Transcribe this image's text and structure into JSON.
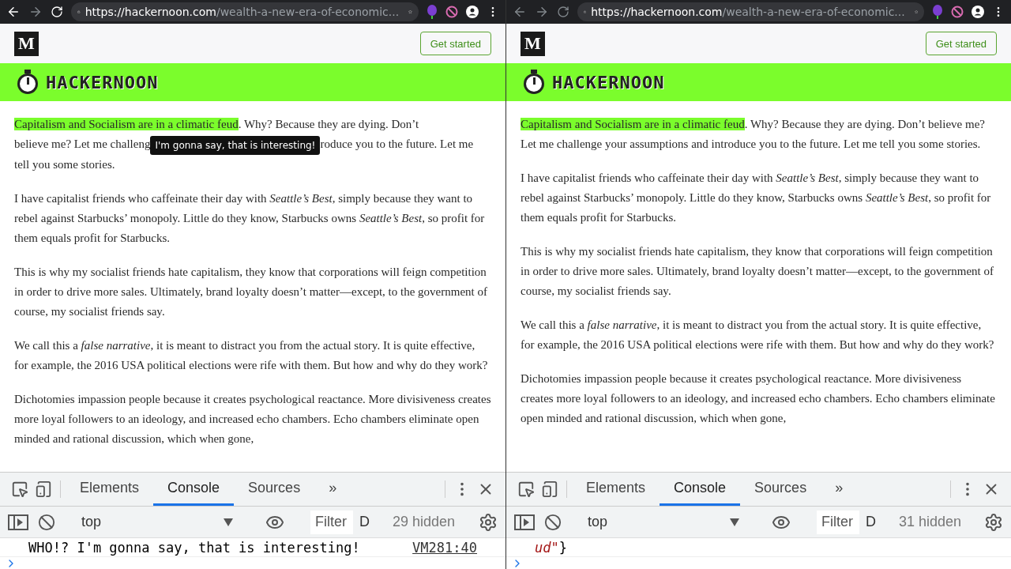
{
  "windows": [
    {
      "focused": true,
      "back_enabled": true,
      "forward_enabled": false,
      "url": {
        "host": "https://hackernoon.com",
        "path": "/wealth-a-new-era-of-economic..."
      },
      "site": {
        "logo": "M",
        "button": "Get started",
        "brand": "HACKERNOON"
      },
      "paragraphs": [
        {
          "segments": [
            {
              "kind": "highlight",
              "text": "Capitalism and Socialism are in a climatic feud"
            },
            {
              "kind": "text",
              "text": ". Why? Because they are dying. Don’t"
            },
            {
              "kind": "break"
            },
            {
              "kind": "text",
              "text": "believe me? Let me challeng"
            },
            {
              "kind": "tooltip",
              "text": "I'm gonna say, that is interesting!"
            },
            {
              "kind": "text",
              "text": "roduce you to the future. Let me"
            },
            {
              "kind": "break"
            },
            {
              "kind": "text",
              "text": "tell you some stories."
            }
          ]
        },
        {
          "segments": [
            {
              "kind": "text",
              "text": "I have capitalist friends who caffeinate their day with *Seattle’s Best*, simply because they want to rebel against Starbucks’ monopoly. Little do they know, Starbucks owns *Seattle’s Best*, so profit for them equals profit for Starbucks."
            }
          ]
        },
        {
          "segments": [
            {
              "kind": "text",
              "text": "This is why my socialist friends hate capitalism, they know that corporations will feign competition in order to drive more sales. Ultimately, brand loyalty doesn’t matter—except, to the government of course, my socialist friends say."
            }
          ]
        },
        {
          "segments": [
            {
              "kind": "text",
              "text": "We call this a *false narrative*, it is meant to distract you from the actual story. It is quite effective, for example, the 2016 USA political elections were rife with them. But how and why do they work?"
            }
          ]
        },
        {
          "segments": [
            {
              "kind": "text",
              "text": "Dichotomies impassion people because it creates psychological reactance. More divisiveness creates more loyal followers to an ideology, and increased echo chambers. Echo chambers eliminate open minded and rational discussion, which when gone,"
            }
          ]
        }
      ],
      "devtools": {
        "tabs": [
          {
            "label": "Elements",
            "selected": false
          },
          {
            "label": "Console",
            "selected": true
          },
          {
            "label": "Sources",
            "selected": false
          }
        ],
        "more": "»",
        "context": "top",
        "filter": {
          "placeholder": "Filter"
        },
        "levels": "D",
        "hidden": "29 hidden",
        "console": [
          {
            "kind": "log",
            "message": "WHO!? I'm gonna say, that is interesting!",
            "source": "VM281:40"
          }
        ]
      }
    },
    {
      "focused": false,
      "back_enabled": false,
      "forward_enabled": false,
      "url": {
        "host": "https://hackernoon.com",
        "path": "/wealth-a-new-era-of-economic..."
      },
      "site": {
        "logo": "M",
        "button": "Get started",
        "brand": "HACKERNOON"
      },
      "paragraphs": [
        {
          "segments": [
            {
              "kind": "highlight",
              "text": "Capitalism and Socialism are in a climatic feud"
            },
            {
              "kind": "text",
              "text": ". Why? Because they are dying. Don’t believe me? Let me challenge your assumptions and introduce you to the future. Let me tell you some stories."
            }
          ]
        },
        {
          "segments": [
            {
              "kind": "text",
              "text": "I have capitalist friends who caffeinate their day with *Seattle’s Best*, simply because they want to rebel against Starbucks’ monopoly. Little do they know, Starbucks owns *Seattle’s Best*, so profit for them equals profit for Starbucks."
            }
          ]
        },
        {
          "segments": [
            {
              "kind": "text",
              "text": "This is why my socialist friends hate capitalism, they know that corporations will feign competition in order to drive more sales. Ultimately, brand loyalty doesn’t matter—except, to the government of course, my socialist friends say."
            }
          ]
        },
        {
          "segments": [
            {
              "kind": "text",
              "text": "We call this a *false narrative*, it is meant to distract you from the actual story. It is quite effective, for example, the 2016 USA political elections were rife with them. But how and why do they work?"
            }
          ]
        },
        {
          "segments": [
            {
              "kind": "text",
              "text": "Dichotomies impassion people because it creates psychological reactance. More divisiveness creates more loyal followers to an ideology, and increased echo chambers. Echo chambers eliminate open minded and rational discussion, which when gone,"
            }
          ]
        }
      ],
      "devtools": {
        "tabs": [
          {
            "label": "Elements",
            "selected": false
          },
          {
            "label": "Console",
            "selected": true
          },
          {
            "label": "Sources",
            "selected": false
          }
        ],
        "more": "»",
        "context": "top",
        "filter": {
          "placeholder": "Filter"
        },
        "levels": "D",
        "hidden": "31 hidden",
        "console": [
          {
            "kind": "fragment",
            "string": "ud\"",
            "brace": "}"
          }
        ]
      }
    }
  ]
}
